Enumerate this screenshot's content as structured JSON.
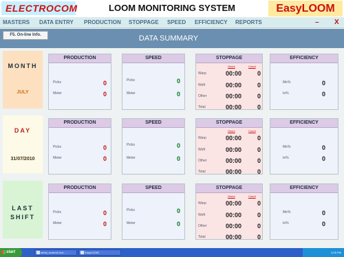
{
  "titlebar": {
    "brand": "ELECTROCOM",
    "app_title": "LOOM MONITORING SYSTEM",
    "product": "EasyLOOM"
  },
  "menu": {
    "items": [
      "MASTERS",
      "DATA ENTRY",
      "PRODUCTION",
      "STOPPAGE",
      "SPEED",
      "EFFICIENCY",
      "REPORTS"
    ],
    "minimize": "–",
    "close": "X"
  },
  "header": {
    "title": "DATA SUMMARY",
    "online_button": "F5. On-line Info."
  },
  "labels": {
    "production": "PRODUCTION",
    "speed": "SPEED",
    "stoppage": "STOPPAGE",
    "efficiency": "EFFICIENCY",
    "picks": "Picks",
    "meter": "Meter",
    "hours": "Hours",
    "count": "Count",
    "warp": "Warp",
    "weft": "Weft",
    "other": "Other",
    "total": "Total",
    "me": "Me%",
    "ie": "Ie%"
  },
  "colors": {
    "accent": "#6b8fb0",
    "value_red": "#c01010",
    "value_green": "#0a7a20",
    "panel_head": "#dccae6"
  },
  "rows": [
    {
      "name": "MONTH",
      "value": "JULY",
      "production": {
        "picks": "0",
        "meter": "0"
      },
      "speed": {
        "picks": "0",
        "meter": "0"
      },
      "stoppage": {
        "warp": {
          "hours": "00:00",
          "count": "0"
        },
        "weft": {
          "hours": "00:00",
          "count": "0"
        },
        "other": {
          "hours": "00:00",
          "count": "0"
        },
        "total": {
          "hours": "00:00",
          "count": "0"
        }
      },
      "efficiency": {
        "me": "0",
        "ie": "0"
      }
    },
    {
      "name": "DAY",
      "value": "31/07/2010",
      "production": {
        "picks": "0",
        "meter": "0"
      },
      "speed": {
        "picks": "0",
        "meter": "0"
      },
      "stoppage": {
        "warp": {
          "hours": "00:00",
          "count": "0"
        },
        "weft": {
          "hours": "00:00",
          "count": "0"
        },
        "other": {
          "hours": "00:00",
          "count": "0"
        },
        "total": {
          "hours": "00:00",
          "count": "0"
        }
      },
      "efficiency": {
        "me": "0",
        "ie": "0"
      }
    },
    {
      "name": "LAST",
      "name2": "SHIFT",
      "value": "",
      "production": {
        "picks": "0",
        "meter": "0"
      },
      "speed": {
        "picks": "0",
        "meter": "0"
      },
      "stoppage": {
        "warp": {
          "hours": "00:00",
          "count": "0"
        },
        "weft": {
          "hours": "00:00",
          "count": "0"
        },
        "other": {
          "hours": "00:00",
          "count": "0"
        },
        "total": {
          "hours": "00:00",
          "count": "0"
        }
      },
      "efficiency": {
        "me": "0",
        "ie": "0"
      }
    }
  ],
  "taskbar": {
    "start": "start",
    "tasks": [
      "serial_screen2.doc - ...",
      "EasyLOOM"
    ],
    "clock": "4:25 PM"
  }
}
